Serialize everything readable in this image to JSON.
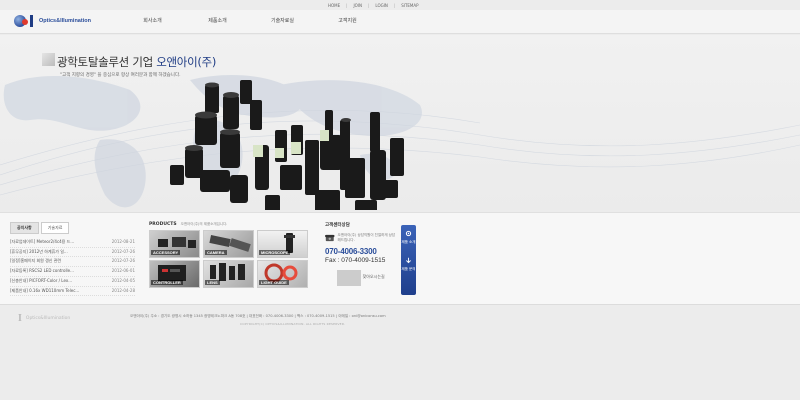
{
  "top_links": [
    "HOME",
    "JOIN",
    "LOGIN",
    "SITEMAP"
  ],
  "logo": {
    "text": "Optics&Illumination"
  },
  "gnb": [
    "회사소개",
    "제품소개",
    "기술자료실",
    "고객지원"
  ],
  "hero": {
    "title_main": "광학토탈솔루션 기업 ",
    "title_accent": "오앤아이(주)",
    "subtitle": "\"고객 지향의 경영\" 을 중심으로 항상 여러분과 함께 하겠습니다."
  },
  "notice": {
    "tabs": [
      "공지사항",
      "기술자료"
    ],
    "items": [
      {
        "title": "[자료업데이트] Meteor2/4c4용 드...",
        "date": "2012-08-21"
      },
      {
        "title": "[휴무공지] 2012년 하계휴가 일...",
        "date": "2012-07-26"
      },
      {
        "title": "[일정]홈페이지 회원 갱신 관련",
        "date": "2012-07-26"
      },
      {
        "title": "[자료등록] RSCS2 LED controlle...",
        "date": "2012-06-01"
      },
      {
        "title": "[신총안내] PICFORT-Color / Lex...",
        "date": "2012-04-05"
      },
      {
        "title": "[제품안내] 0.16x WD110mm Telec...",
        "date": "2012-04-28"
      }
    ]
  },
  "products": {
    "title": "PRODUCTS",
    "subtitle": "오앤아이(주)의 제품소개입니다.",
    "items": [
      "ACCESSORY",
      "CAMERA",
      "MICROSCOPE",
      "CONTROLLER",
      "LENS",
      "LIGHT GUIDE"
    ]
  },
  "contact": {
    "title": "고객센터상담",
    "desc": "오앤아이(주) 상담직원이 친절하게 상담해드립니다.",
    "tel": "070-4006-3300",
    "fax": "Fax : 070-4009-1515",
    "hours": "찾아오시는길"
  },
  "quick": [
    "제품 소개",
    "제품 문의"
  ],
  "footer": {
    "address": "오앤아이(주)  주소 : 경기도 광명시 소하동 1345 광명테크노파크 A동 708호  |  대표전화 : 070-4006-3300  |  팩스 : 070-4009-1515  |  이메일 : oni@oniconsu.com",
    "copyright": "COPYRIGHT(C) OPTICS&ILLUMINATION. ALL RIGHTS RESERVED.",
    "logo_text": "Optics&Illumination"
  },
  "colors": {
    "brand_blue": "#2a4d9a",
    "brand_red": "#e03a2e"
  }
}
